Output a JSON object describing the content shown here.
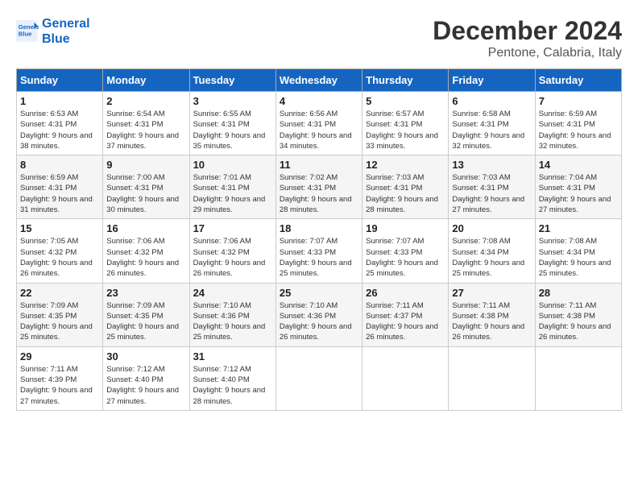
{
  "logo": {
    "line1": "General",
    "line2": "Blue"
  },
  "title": "December 2024",
  "subtitle": "Pentone, Calabria, Italy",
  "days_header": [
    "Sunday",
    "Monday",
    "Tuesday",
    "Wednesday",
    "Thursday",
    "Friday",
    "Saturday"
  ],
  "weeks": [
    [
      {
        "day": "1",
        "sunrise": "6:53 AM",
        "sunset": "4:31 PM",
        "daylight": "9 hours and 38 minutes."
      },
      {
        "day": "2",
        "sunrise": "6:54 AM",
        "sunset": "4:31 PM",
        "daylight": "9 hours and 37 minutes."
      },
      {
        "day": "3",
        "sunrise": "6:55 AM",
        "sunset": "4:31 PM",
        "daylight": "9 hours and 35 minutes."
      },
      {
        "day": "4",
        "sunrise": "6:56 AM",
        "sunset": "4:31 PM",
        "daylight": "9 hours and 34 minutes."
      },
      {
        "day": "5",
        "sunrise": "6:57 AM",
        "sunset": "4:31 PM",
        "daylight": "9 hours and 33 minutes."
      },
      {
        "day": "6",
        "sunrise": "6:58 AM",
        "sunset": "4:31 PM",
        "daylight": "9 hours and 32 minutes."
      },
      {
        "day": "7",
        "sunrise": "6:59 AM",
        "sunset": "4:31 PM",
        "daylight": "9 hours and 32 minutes."
      }
    ],
    [
      {
        "day": "8",
        "sunrise": "6:59 AM",
        "sunset": "4:31 PM",
        "daylight": "9 hours and 31 minutes."
      },
      {
        "day": "9",
        "sunrise": "7:00 AM",
        "sunset": "4:31 PM",
        "daylight": "9 hours and 30 minutes."
      },
      {
        "day": "10",
        "sunrise": "7:01 AM",
        "sunset": "4:31 PM",
        "daylight": "9 hours and 29 minutes."
      },
      {
        "day": "11",
        "sunrise": "7:02 AM",
        "sunset": "4:31 PM",
        "daylight": "9 hours and 28 minutes."
      },
      {
        "day": "12",
        "sunrise": "7:03 AM",
        "sunset": "4:31 PM",
        "daylight": "9 hours and 28 minutes."
      },
      {
        "day": "13",
        "sunrise": "7:03 AM",
        "sunset": "4:31 PM",
        "daylight": "9 hours and 27 minutes."
      },
      {
        "day": "14",
        "sunrise": "7:04 AM",
        "sunset": "4:31 PM",
        "daylight": "9 hours and 27 minutes."
      }
    ],
    [
      {
        "day": "15",
        "sunrise": "7:05 AM",
        "sunset": "4:32 PM",
        "daylight": "9 hours and 26 minutes."
      },
      {
        "day": "16",
        "sunrise": "7:06 AM",
        "sunset": "4:32 PM",
        "daylight": "9 hours and 26 minutes."
      },
      {
        "day": "17",
        "sunrise": "7:06 AM",
        "sunset": "4:32 PM",
        "daylight": "9 hours and 26 minutes."
      },
      {
        "day": "18",
        "sunrise": "7:07 AM",
        "sunset": "4:33 PM",
        "daylight": "9 hours and 25 minutes."
      },
      {
        "day": "19",
        "sunrise": "7:07 AM",
        "sunset": "4:33 PM",
        "daylight": "9 hours and 25 minutes."
      },
      {
        "day": "20",
        "sunrise": "7:08 AM",
        "sunset": "4:34 PM",
        "daylight": "9 hours and 25 minutes."
      },
      {
        "day": "21",
        "sunrise": "7:08 AM",
        "sunset": "4:34 PM",
        "daylight": "9 hours and 25 minutes."
      }
    ],
    [
      {
        "day": "22",
        "sunrise": "7:09 AM",
        "sunset": "4:35 PM",
        "daylight": "9 hours and 25 minutes."
      },
      {
        "day": "23",
        "sunrise": "7:09 AM",
        "sunset": "4:35 PM",
        "daylight": "9 hours and 25 minutes."
      },
      {
        "day": "24",
        "sunrise": "7:10 AM",
        "sunset": "4:36 PM",
        "daylight": "9 hours and 25 minutes."
      },
      {
        "day": "25",
        "sunrise": "7:10 AM",
        "sunset": "4:36 PM",
        "daylight": "9 hours and 26 minutes."
      },
      {
        "day": "26",
        "sunrise": "7:11 AM",
        "sunset": "4:37 PM",
        "daylight": "9 hours and 26 minutes."
      },
      {
        "day": "27",
        "sunrise": "7:11 AM",
        "sunset": "4:38 PM",
        "daylight": "9 hours and 26 minutes."
      },
      {
        "day": "28",
        "sunrise": "7:11 AM",
        "sunset": "4:38 PM",
        "daylight": "9 hours and 26 minutes."
      }
    ],
    [
      {
        "day": "29",
        "sunrise": "7:11 AM",
        "sunset": "4:39 PM",
        "daylight": "9 hours and 27 minutes."
      },
      {
        "day": "30",
        "sunrise": "7:12 AM",
        "sunset": "4:40 PM",
        "daylight": "9 hours and 27 minutes."
      },
      {
        "day": "31",
        "sunrise": "7:12 AM",
        "sunset": "4:40 PM",
        "daylight": "9 hours and 28 minutes."
      },
      null,
      null,
      null,
      null
    ]
  ],
  "labels": {
    "sunrise": "Sunrise:",
    "sunset": "Sunset:",
    "daylight": "Daylight:"
  }
}
